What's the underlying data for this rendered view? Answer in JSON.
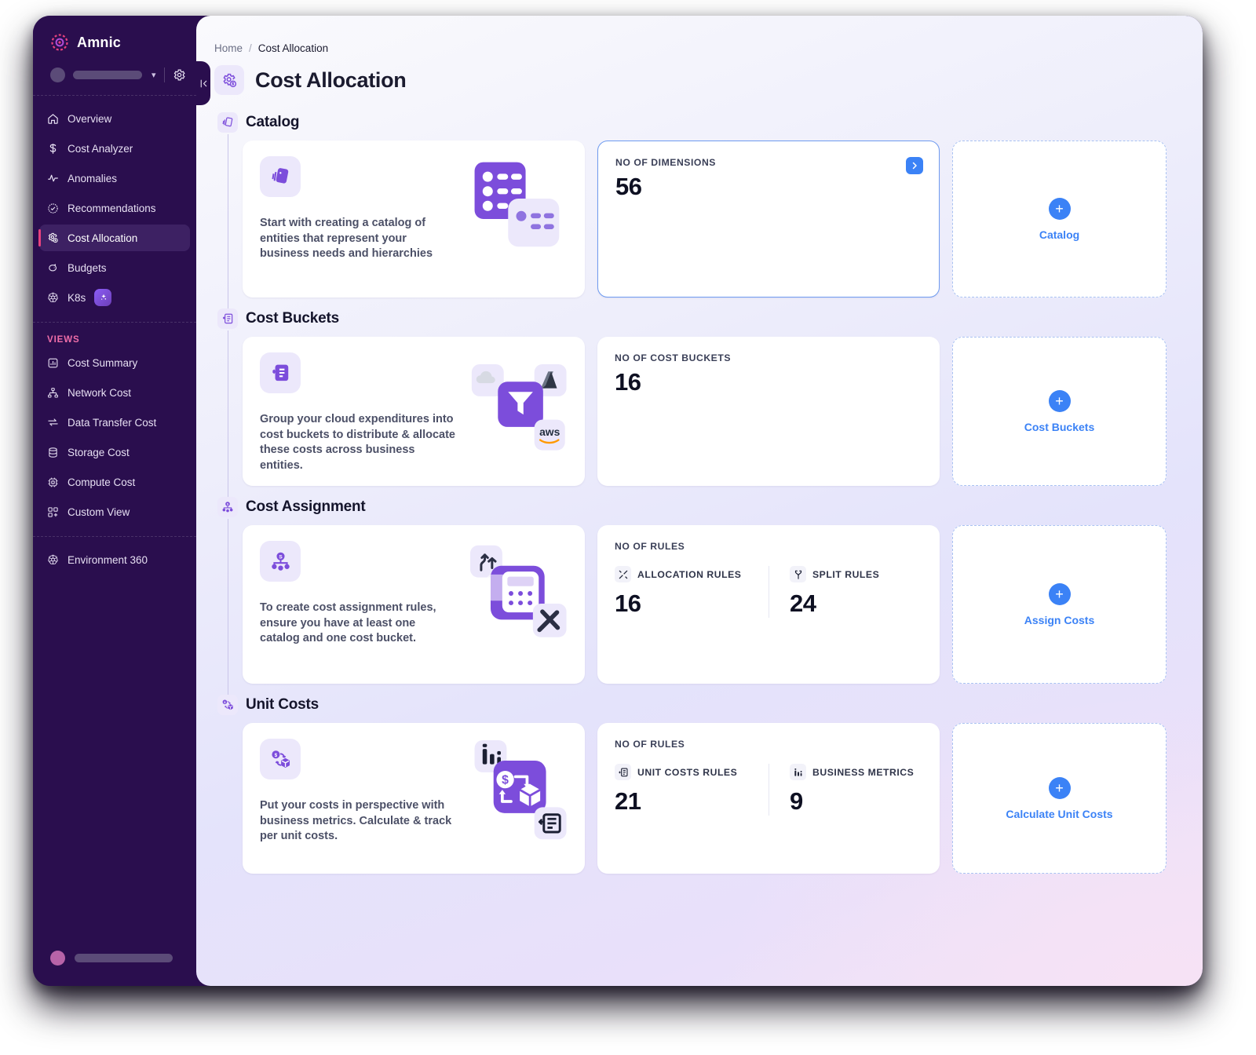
{
  "brand": {
    "name": "Amnic"
  },
  "sidebar": {
    "nav": [
      {
        "label": "Overview",
        "icon": "home-icon"
      },
      {
        "label": "Cost Analyzer",
        "icon": "dollar-icon"
      },
      {
        "label": "Anomalies",
        "icon": "activity-icon"
      },
      {
        "label": "Recommendations",
        "icon": "check-badge-icon"
      },
      {
        "label": "Cost Allocation",
        "icon": "gear-dollar-icon",
        "active": true
      },
      {
        "label": "Budgets",
        "icon": "piggy-bank-icon"
      },
      {
        "label": "K8s",
        "icon": "kubernetes-icon",
        "badge": "sparkle-icon"
      }
    ],
    "views_label": "VIEWS",
    "views": [
      {
        "label": "Cost Summary",
        "icon": "bar-chart-box-icon"
      },
      {
        "label": "Network Cost",
        "icon": "network-icon"
      },
      {
        "label": "Data Transfer Cost",
        "icon": "transfer-arrows-icon"
      },
      {
        "label": "Storage Cost",
        "icon": "database-icon"
      },
      {
        "label": "Compute Cost",
        "icon": "cpu-icon"
      },
      {
        "label": "Custom View",
        "icon": "custom-grid-icon"
      }
    ],
    "footer_nav": [
      {
        "label": "Environment 360",
        "icon": "kubernetes-icon"
      }
    ]
  },
  "header": {
    "breadcrumb": {
      "home": "Home",
      "separator": "/",
      "current": "Cost Allocation"
    },
    "title": "Cost Allocation",
    "title_icon": "gear-dollar-icon"
  },
  "colors": {
    "accent_blue": "#3b82f6",
    "brand_purple": "#7c4ddb",
    "sidebar_bg": "#2a0e4e",
    "active_pink": "#e8417e"
  },
  "sections": [
    {
      "title": "Catalog",
      "icon": "catalog-cards-icon",
      "info_text": "Start with creating a catalog of entities that represent your business needs and hierarchies",
      "info_icon": "catalog-cards-icon",
      "stat": {
        "label": "NO OF DIMENSIONS",
        "value": "56",
        "has_arrow": true,
        "highlighted": true
      },
      "add": {
        "label": "Catalog",
        "icon": "plus-icon"
      }
    },
    {
      "title": "Cost Buckets",
      "icon": "cost-bucket-icon",
      "info_text": "Group your cloud expenditures into cost buckets to distribute & allocate these costs across business entities.",
      "info_icon": "cost-bucket-icon",
      "stat": {
        "label": "NO OF COST BUCKETS",
        "value": "16",
        "has_arrow": false,
        "highlighted": false
      },
      "add": {
        "label": "Cost Buckets",
        "icon": "plus-icon"
      }
    },
    {
      "title": "Cost Assignment",
      "icon": "cost-assignment-icon",
      "info_text": "To create cost assignment rules, ensure you have at least one catalog and one cost bucket.",
      "info_icon": "cost-assignment-icon",
      "stat": {
        "label": "NO OF RULES",
        "metrics": [
          {
            "name": "ALLOCATION RULES",
            "value": "16",
            "icon": "allocation-rules-icon"
          },
          {
            "name": "SPLIT RULES",
            "value": "24",
            "icon": "split-rules-icon"
          }
        ]
      },
      "add": {
        "label": "Assign Costs",
        "icon": "plus-icon"
      }
    },
    {
      "title": "Unit Costs",
      "icon": "unit-costs-icon",
      "info_text": "Put your costs in perspective with business metrics. Calculate & track per unit costs.",
      "info_icon": "unit-costs-icon",
      "stat": {
        "label": "NO OF RULES",
        "metrics": [
          {
            "name": "UNIT COSTS RULES",
            "value": "21",
            "icon": "unit-costs-rules-icon"
          },
          {
            "name": "BUSINESS METRICS",
            "value": "9",
            "icon": "business-metrics-icon"
          }
        ]
      },
      "add": {
        "label": "Calculate Unit Costs",
        "icon": "plus-icon"
      }
    }
  ]
}
